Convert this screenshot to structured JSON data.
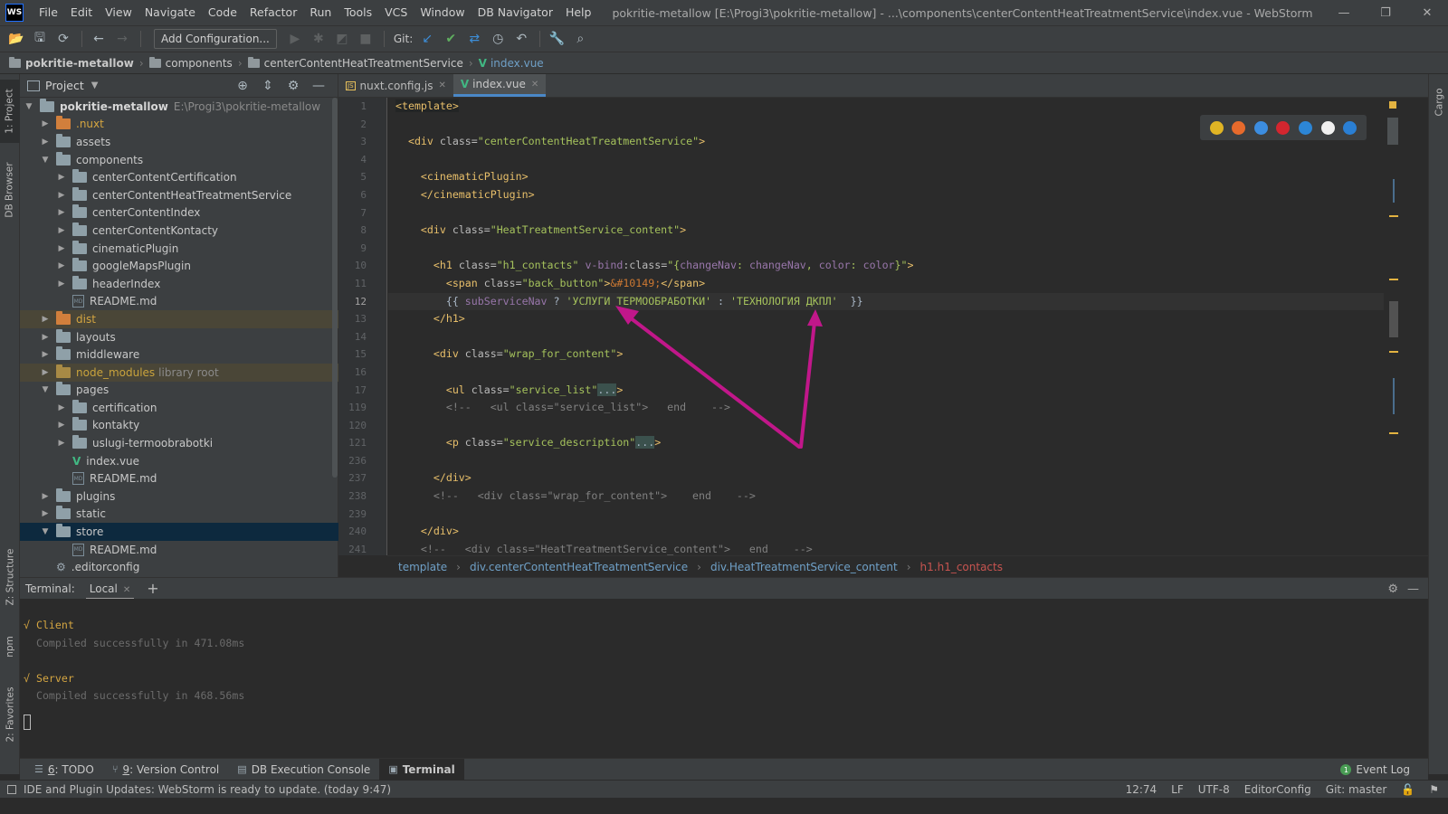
{
  "window": {
    "logo": "WS",
    "title": "pokritie-metallow [E:\\Progi3\\pokritie-metallow] - ...\\components\\centerContentHeatTreatmentService\\index.vue - WebStorm",
    "controls": [
      "minimize-icon",
      "restore-icon",
      "close-icon"
    ]
  },
  "menu": [
    "File",
    "Edit",
    "View",
    "Navigate",
    "Code",
    "Refactor",
    "Run",
    "Tools",
    "VCS",
    "Window",
    "DB Navigator",
    "Help"
  ],
  "toolbar": {
    "add_config_label": "Add Configuration...",
    "git_label": "Git:"
  },
  "navbar": {
    "crumbs": [
      "pokritie-metallow",
      "components",
      "centerContentHeatTreatmentService",
      "index.vue"
    ]
  },
  "left_stripe": {
    "project_tab": "1: Project",
    "db_tab": "DB Browser",
    "structure_tab": "Z: Structure",
    "npm_tab": "npm",
    "favorites_tab": "2: Favorites"
  },
  "right_stripe": {
    "cargo_tab": "Cargo"
  },
  "project_panel": {
    "title": "Project",
    "tree": [
      {
        "label": "pokritie-metallow",
        "path": "E:\\Progi3\\pokritie-metallow",
        "level": 0,
        "arrow": "▼",
        "icon": "folder",
        "kind": "root"
      },
      {
        "label": ".nuxt",
        "level": 1,
        "arrow": "▶",
        "icon": "folder-orange",
        "kind": "nuxt"
      },
      {
        "label": "assets",
        "level": 1,
        "arrow": "▶",
        "icon": "folder"
      },
      {
        "label": "components",
        "level": 1,
        "arrow": "▼",
        "icon": "folder"
      },
      {
        "label": "centerContentCertification",
        "level": 2,
        "arrow": "▶",
        "icon": "folder"
      },
      {
        "label": "centerContentHeatTreatmentService",
        "level": 2,
        "arrow": "▶",
        "icon": "folder"
      },
      {
        "label": "centerContentIndex",
        "level": 2,
        "arrow": "▶",
        "icon": "folder"
      },
      {
        "label": "centerContentKontacty",
        "level": 2,
        "arrow": "▶",
        "icon": "folder"
      },
      {
        "label": "cinematicPlugin",
        "level": 2,
        "arrow": "▶",
        "icon": "folder"
      },
      {
        "label": "googleMapsPlugin",
        "level": 2,
        "arrow": "▶",
        "icon": "folder"
      },
      {
        "label": "headerIndex",
        "level": 2,
        "arrow": "▶",
        "icon": "folder"
      },
      {
        "label": "README.md",
        "level": 2,
        "arrow": "",
        "icon": "md"
      },
      {
        "label": "dist",
        "level": 1,
        "arrow": "▶",
        "icon": "folder-orange",
        "kind": "dist"
      },
      {
        "label": "layouts",
        "level": 1,
        "arrow": "▶",
        "icon": "folder"
      },
      {
        "label": "middleware",
        "level": 1,
        "arrow": "▶",
        "icon": "folder"
      },
      {
        "label": "node_modules",
        "suffix": "library root",
        "level": 1,
        "arrow": "▶",
        "icon": "folder-yellow",
        "kind": "nodemod"
      },
      {
        "label": "pages",
        "level": 1,
        "arrow": "▼",
        "icon": "folder"
      },
      {
        "label": "certification",
        "level": 2,
        "arrow": "▶",
        "icon": "folder"
      },
      {
        "label": "kontakty",
        "level": 2,
        "arrow": "▶",
        "icon": "folder"
      },
      {
        "label": "uslugi-termoobrabotki",
        "level": 2,
        "arrow": "▶",
        "icon": "folder"
      },
      {
        "label": "index.vue",
        "level": 2,
        "arrow": "",
        "icon": "vue"
      },
      {
        "label": "README.md",
        "level": 2,
        "arrow": "",
        "icon": "md"
      },
      {
        "label": "plugins",
        "level": 1,
        "arrow": "▶",
        "icon": "folder"
      },
      {
        "label": "static",
        "level": 1,
        "arrow": "▶",
        "icon": "folder"
      },
      {
        "label": "store",
        "level": 1,
        "arrow": "▼",
        "icon": "folder",
        "kind": "selected"
      },
      {
        "label": "README.md",
        "level": 2,
        "arrow": "",
        "icon": "md"
      },
      {
        "label": ".editorconfig",
        "level": 1,
        "arrow": "",
        "icon": "gear"
      }
    ]
  },
  "editor": {
    "tabs": [
      {
        "label": "nuxt.config.js",
        "icon": "js",
        "active": false
      },
      {
        "label": "index.vue",
        "icon": "vue",
        "active": true
      }
    ],
    "line_numbers": [
      "1",
      "2",
      "3",
      "4",
      "5",
      "6",
      "7",
      "8",
      "9",
      "10",
      "11",
      "12",
      "13",
      "14",
      "15",
      "16",
      "17",
      "119",
      "120",
      "121",
      "236",
      "237",
      "238",
      "239",
      "240",
      "241"
    ],
    "current_line": "12",
    "lines": [
      [
        {
          "t": "<template>",
          "c": "tag tpl"
        }
      ],
      [],
      [
        {
          "t": "  "
        },
        {
          "t": "<div ",
          "c": "tag"
        },
        {
          "t": "class=",
          "c": "attr"
        },
        {
          "t": "\"centerContentHeatTreatmentService\"",
          "c": "str"
        },
        {
          "t": ">",
          "c": "tag"
        }
      ],
      [],
      [
        {
          "t": "    "
        },
        {
          "t": "<cinematicPlugin>",
          "c": "tag"
        }
      ],
      [
        {
          "t": "    "
        },
        {
          "t": "</cinematicPlugin>",
          "c": "tag"
        }
      ],
      [],
      [
        {
          "t": "    "
        },
        {
          "t": "<div ",
          "c": "tag"
        },
        {
          "t": "class=",
          "c": "attr"
        },
        {
          "t": "\"HeatTreatmentService_content\"",
          "c": "str"
        },
        {
          "t": ">",
          "c": "tag"
        }
      ],
      [],
      [
        {
          "t": "      "
        },
        {
          "t": "<h1 ",
          "c": "tag"
        },
        {
          "t": "class=",
          "c": "attr"
        },
        {
          "t": "\"h1_contacts\" ",
          "c": "str"
        },
        {
          "t": "v-bind",
          "c": "ident"
        },
        {
          "t": ":class=",
          "c": "attr"
        },
        {
          "t": "\"{",
          "c": "str"
        },
        {
          "t": "changeNav",
          "c": "ident"
        },
        {
          "t": ": ",
          "c": "str"
        },
        {
          "t": "changeNav",
          "c": "ident"
        },
        {
          "t": ", ",
          "c": "str"
        },
        {
          "t": "color",
          "c": "ident"
        },
        {
          "t": ": ",
          "c": "str"
        },
        {
          "t": "color",
          "c": "ident"
        },
        {
          "t": "}\"",
          "c": "str"
        },
        {
          "t": ">",
          "c": "tag"
        }
      ],
      [
        {
          "t": "        "
        },
        {
          "t": "<span ",
          "c": "tag"
        },
        {
          "t": "class=",
          "c": "attr"
        },
        {
          "t": "\"back_button\"",
          "c": "str"
        },
        {
          "t": ">",
          "c": "tag"
        },
        {
          "t": "&#10149;",
          "c": "ent"
        },
        {
          "t": "</span>",
          "c": "tag"
        }
      ],
      [
        {
          "t": "        {{ "
        },
        {
          "t": "subServiceNav",
          "c": "ident"
        },
        {
          "t": " ? "
        },
        {
          "t": "'УСЛУГИ ТЕРМООБРАБОТКИ'",
          "c": "str"
        },
        {
          "t": " : "
        },
        {
          "t": "'ТЕХНОЛОГИЯ ДКПЛ'",
          "c": "str"
        },
        {
          "t": "  }}"
        }
      ],
      [
        {
          "t": "      "
        },
        {
          "t": "</h1>",
          "c": "tag"
        }
      ],
      [],
      [
        {
          "t": "      "
        },
        {
          "t": "<div ",
          "c": "tag"
        },
        {
          "t": "class=",
          "c": "attr"
        },
        {
          "t": "\"wrap_for_content\"",
          "c": "str"
        },
        {
          "t": ">",
          "c": "tag"
        }
      ],
      [],
      [
        {
          "t": "        "
        },
        {
          "t": "<ul ",
          "c": "tag"
        },
        {
          "t": "class=",
          "c": "attr"
        },
        {
          "t": "\"service_list\"",
          "c": "str"
        },
        {
          "t": "...",
          "c": "fold"
        },
        {
          "t": ">",
          "c": "tag"
        }
      ],
      [
        {
          "t": "        <!--   <ul class=\"service_list\">   end    -->",
          "c": "cmt"
        }
      ],
      [],
      [
        {
          "t": "        "
        },
        {
          "t": "<p ",
          "c": "tag"
        },
        {
          "t": "class=",
          "c": "attr"
        },
        {
          "t": "\"service_description\"",
          "c": "str"
        },
        {
          "t": "...",
          "c": "fold"
        },
        {
          "t": ">",
          "c": "tag"
        }
      ],
      [],
      [
        {
          "t": "      "
        },
        {
          "t": "</div>",
          "c": "tag"
        }
      ],
      [
        {
          "t": "      <!--   <div class=\"wrap_for_content\">    end    -->",
          "c": "cmt"
        }
      ],
      [],
      [
        {
          "t": "    "
        },
        {
          "t": "</div>",
          "c": "tag"
        }
      ],
      [
        {
          "t": "    <!--   <div class=\"HeatTreatmentService_content\">   end    -->",
          "c": "cmt"
        }
      ]
    ],
    "breadcrumbs": [
      "template",
      "div.centerContentHeatTreatmentService",
      "div.HeatTreatmentService_content",
      "h1.h1_contacts"
    ],
    "browser_icons": [
      {
        "name": "chrome-icon",
        "color": "#e0b424"
      },
      {
        "name": "firefox-icon",
        "color": "#e66a2c"
      },
      {
        "name": "safari-icon",
        "color": "#3c8de0"
      },
      {
        "name": "opera-icon",
        "color": "#d3262f"
      },
      {
        "name": "ie-icon",
        "color": "#2c86d6"
      },
      {
        "name": "yandex-icon",
        "color": "#f0f0f0"
      },
      {
        "name": "edge-icon",
        "color": "#2a7fd4"
      }
    ]
  },
  "terminal": {
    "label": "Terminal:",
    "tab": "Local",
    "lines": [
      {
        "text": "√ Client",
        "kind": "ok"
      },
      {
        "text": "  Compiled successfully in 471.08ms",
        "kind": "grey"
      },
      {
        "text": "",
        "kind": "grey"
      },
      {
        "text": "√ Server",
        "kind": "ok"
      },
      {
        "text": "  Compiled successfully in 468.56ms",
        "kind": "grey"
      }
    ]
  },
  "bottom_bar": {
    "items": [
      {
        "num": "6",
        "label": ": TODO",
        "icon": "todo-icon",
        "glyph": "☰"
      },
      {
        "num": "9",
        "label": ": Version Control",
        "icon": "vcs-icon",
        "glyph": "⑂"
      },
      {
        "num": "",
        "label": "DB Execution Console",
        "icon": "db-console-icon",
        "glyph": "▤"
      },
      {
        "num": "",
        "label": "Terminal",
        "icon": "terminal-icon",
        "glyph": "▣",
        "active": true
      }
    ],
    "event_log": "Event Log",
    "event_count": "1"
  },
  "status_bar": {
    "message": "IDE and Plugin Updates: WebStorm is ready to update. (today 9:47)",
    "position": "12:74",
    "line_sep": "LF",
    "encoding": "UTF-8",
    "editorconfig": "EditorConfig",
    "git": "Git: master"
  },
  "annotation": {
    "arrow_color": "#c1178a"
  }
}
